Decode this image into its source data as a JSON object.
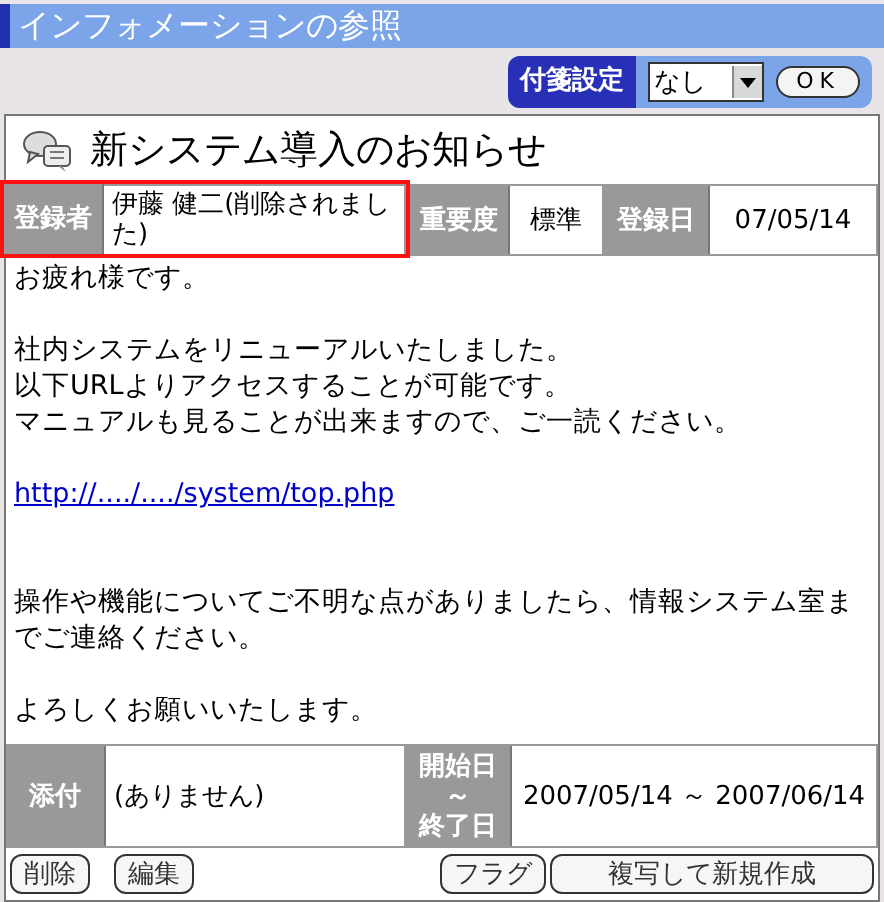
{
  "window": {
    "title": "インフォメーションの参照"
  },
  "sticky_setting": {
    "label": "付箋設定",
    "value": "なし",
    "ok_button": "OK"
  },
  "notice": {
    "title": "新システム導入のお知らせ",
    "info": [
      {
        "label": "登録者",
        "value": "伊藤 健二(削除されました)",
        "highlighted": true
      },
      {
        "label": "重要度",
        "value": "標準",
        "highlighted": false
      },
      {
        "label": "登録日",
        "value": "07/05/14",
        "highlighted": false
      }
    ],
    "body": [
      {
        "kind": "text",
        "text": "お疲れ様です。"
      },
      {
        "kind": "blank"
      },
      {
        "kind": "text",
        "text": "社内システムをリニューアルいたしました。"
      },
      {
        "kind": "text",
        "text": "以下URLよりアクセスすることが可能です。"
      },
      {
        "kind": "text",
        "text": "マニュアルも見ることが出来ますので、ご一読ください。"
      },
      {
        "kind": "blank"
      },
      {
        "kind": "link",
        "text": "http://..../..../system/top.php"
      },
      {
        "kind": "blank"
      },
      {
        "kind": "blank"
      },
      {
        "kind": "text",
        "text": "操作や機能についてご不明な点がありましたら、情報システム室までご連絡ください。"
      },
      {
        "kind": "blank"
      },
      {
        "kind": "text",
        "text": "よろしくお願いいたします。"
      }
    ],
    "attachment": {
      "label": "添付",
      "value": "(ありません)"
    },
    "period": {
      "label_start": "開始日",
      "label_sep": "～",
      "label_end": "終了日",
      "value": "2007/05/14 ～ 2007/06/14"
    }
  },
  "buttons_left": [
    "削除",
    "編集"
  ],
  "buttons_right": [
    "フラグ",
    "複写して新規作成"
  ]
}
